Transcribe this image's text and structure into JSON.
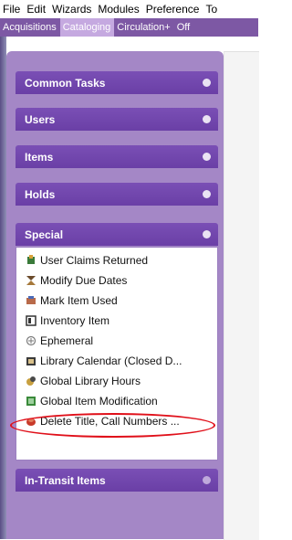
{
  "menu": [
    "File",
    "Edit",
    "Wizards",
    "Modules",
    "Preference",
    "To"
  ],
  "modules": [
    {
      "label": "Acquisitions",
      "active": false
    },
    {
      "label": "Cataloging",
      "active": true
    },
    {
      "label": "Circulation+",
      "active": false
    },
    {
      "label": "Off",
      "active": false
    }
  ],
  "sections": {
    "common_tasks": "Common Tasks",
    "users": "Users",
    "items": "Items",
    "holds": "Holds",
    "special": "Special",
    "in_transit": "In-Transit Items"
  },
  "special_tasks": [
    {
      "label": "User Claims Returned",
      "icon": "user-claims-icon"
    },
    {
      "label": "Modify Due Dates",
      "icon": "modify-due-dates-icon"
    },
    {
      "label": "Mark Item Used",
      "icon": "mark-item-used-icon"
    },
    {
      "label": "Inventory Item",
      "icon": "inventory-item-icon"
    },
    {
      "label": "Ephemeral",
      "icon": "ephemeral-icon"
    },
    {
      "label": "Library Calendar (Closed D...",
      "icon": "library-calendar-icon"
    },
    {
      "label": "Global Library Hours",
      "icon": "global-library-hours-icon"
    },
    {
      "label": "Global Item Modification",
      "icon": "global-item-modification-icon"
    },
    {
      "label": "Delete Title, Call Numbers ...",
      "icon": "delete-title-icon"
    }
  ],
  "colors": {
    "module_bar": "#7d58a4",
    "panel": "#a487c6",
    "section_header": "#6f45ac",
    "highlight_circle": "#e0101a"
  }
}
